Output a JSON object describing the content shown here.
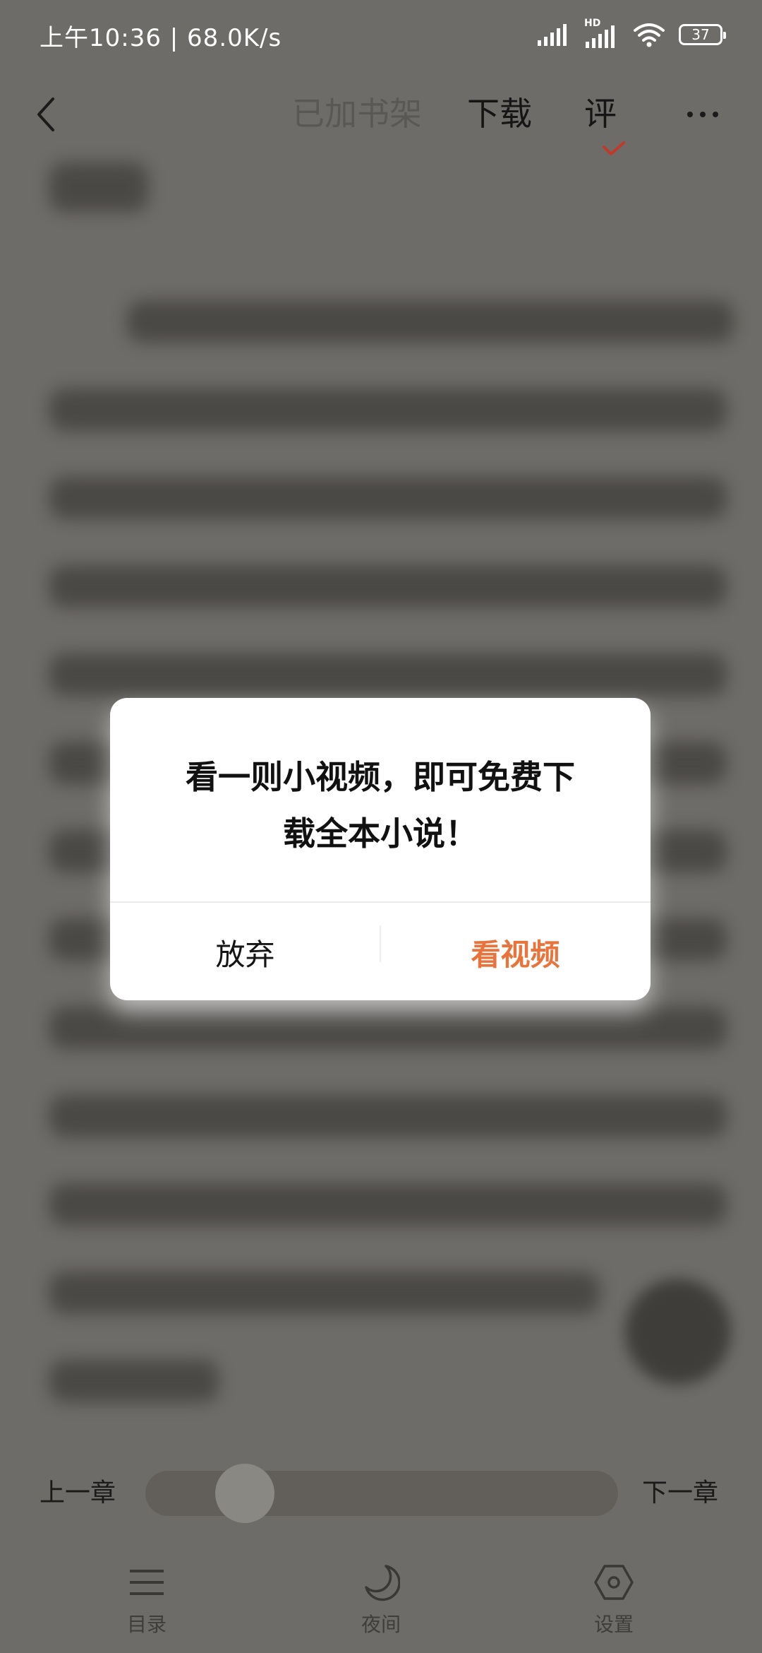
{
  "status_bar": {
    "time_speed": "上午10:36 | 68.0K/s",
    "hd_label": "HD",
    "battery": "37",
    "icons": [
      "signal-icon",
      "hd-signal-icon",
      "wifi-icon",
      "battery-icon"
    ]
  },
  "nav": {
    "back_icon": "chevron-left-icon",
    "bookshelf": "已加书架",
    "download": "下载",
    "review": "评",
    "more_icon": "more-dots-icon"
  },
  "dialog": {
    "message_line1": "看一则小视频，即可免费下",
    "message_line2": "载全本小说！",
    "cancel": "放弃",
    "confirm": "看视频",
    "confirm_color": "#e8743b"
  },
  "chapter": {
    "prev": "上一章",
    "next": "下一章",
    "progress": 0.11
  },
  "toolbar": {
    "toc": "目录",
    "night": "夜间",
    "settings": "设置",
    "icons": [
      "menu-lines-icon",
      "moon-icon",
      "hexagon-settings-icon"
    ]
  }
}
